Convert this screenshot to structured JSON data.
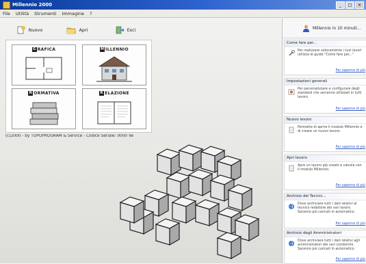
{
  "window": {
    "title": "Millennio 2000",
    "buttons": {
      "minimize": "_",
      "maximize": "□",
      "close": "×"
    }
  },
  "menu": [
    "File",
    "Utilità",
    "Strumenti",
    "Immagine",
    "?"
  ],
  "toolbar": [
    {
      "label": "Nuovo",
      "icon": "new-doc-icon"
    },
    {
      "label": "Apri",
      "icon": "open-folder-icon"
    },
    {
      "label": "Esci",
      "icon": "exit-icon"
    }
  ],
  "tiles": [
    {
      "initial": "G",
      "label": "RAFICA"
    },
    {
      "initial": "M",
      "label": "ILLENNIO"
    },
    {
      "initial": "N",
      "label": "ORMATIVA"
    },
    {
      "initial": "R",
      "label": "ELAZIONE"
    }
  ],
  "copyright": "(c)2000 - by TOPOPROGRAM & Service - Codice Seriale: 0000   Ve",
  "sidebar": {
    "header": "Millennio in 10 minuti...",
    "sections": [
      {
        "title": "Come fare per...",
        "desc": "Per realizzare velocemente i tuoi lavori utilizza le guide \"Come fare per...\"",
        "more": "Per saperne di più"
      },
      {
        "title": "Impostazioni generali",
        "desc": "Per personalizzare e configurare degli standard che verranno utilizzati in tutti lavoro.",
        "more": "Per saperne di più"
      },
      {
        "title": "Nuovo lavoro",
        "desc": "Permette di aprire il modulo Millennio e di creare un nuovo lavoro.",
        "more": "Per saperne di più"
      },
      {
        "title": "Apri lavoro",
        "desc": "Apre un lavoro già creato e calcola con il modulo Millennio.",
        "more": "Per saperne di più"
      },
      {
        "title": "Archivio dei Tecnici...",
        "desc": "Dove archiviare tutti i dati relativi al tecnico redattore dei vari lavoro. Saranno poi caricati in automatico.",
        "more": "Per saperne di più"
      },
      {
        "title": "Archivio degli Amministratori",
        "desc": "Dove archiviare tutti i dati relativi agli amministratori dei vari condomini. Saranno poi caricati in automatico.",
        "more": "Per saperne di più"
      }
    ]
  },
  "colors": {
    "titlebar": "#0a3a9a",
    "link": "#2d5bc6",
    "accent": "#e8c24a"
  }
}
